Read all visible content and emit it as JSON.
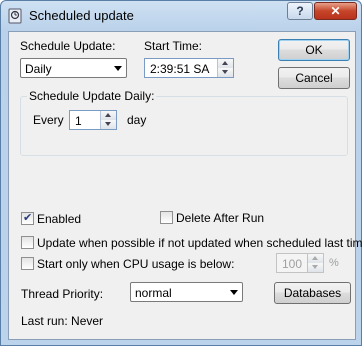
{
  "window": {
    "title": "Scheduled update",
    "help_glyph": "?",
    "close_glyph": "✕"
  },
  "schedule": {
    "label": "Schedule Update:",
    "value": "Daily"
  },
  "start_time": {
    "label": "Start Time:",
    "value": "2:39:51 SA"
  },
  "buttons": {
    "ok": "OK",
    "cancel": "Cancel",
    "databases": "Databases"
  },
  "daily_group": {
    "title": "Schedule Update Daily:",
    "every_label": "Every",
    "every_value": "1",
    "unit": "day"
  },
  "options": {
    "enabled": {
      "label": "Enabled",
      "checked": true
    },
    "delete_after_run": {
      "label": "Delete After Run",
      "checked": false
    },
    "update_when_possible": {
      "label": "Update when possible if not updated when scheduled last time",
      "checked": false
    },
    "start_only_cpu": {
      "label": "Start only when CPU usage is below:",
      "checked": false,
      "value": "100",
      "unit": "%"
    }
  },
  "thread_priority": {
    "label": "Thread Priority:",
    "value": "normal"
  },
  "last_run": "Last run: Never"
}
